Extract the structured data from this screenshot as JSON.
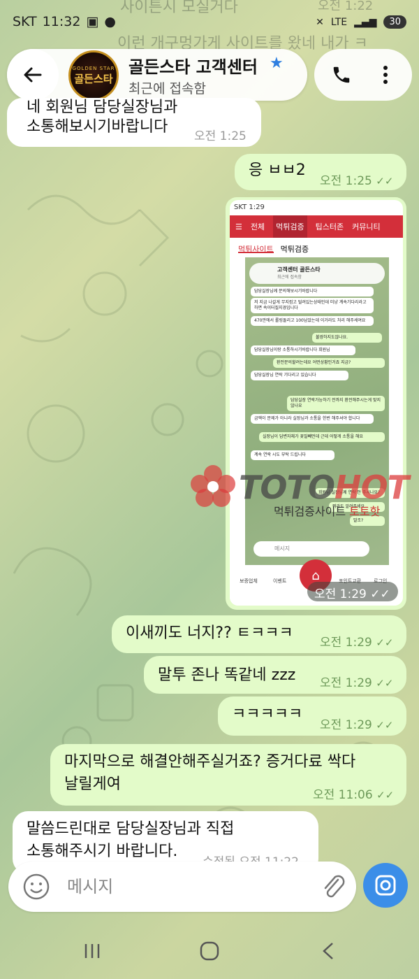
{
  "status_bar": {
    "carrier": "SKT",
    "time": "11:32",
    "network": "LTE",
    "battery": "30"
  },
  "ghost_lines": [
    "사이튼시 모실거다",
    "이런 개구멍가게 사이트를 왔네 내가 ㅋ"
  ],
  "ghost_time": "오전 1:22",
  "header": {
    "title": "골든스타 고객센터",
    "status": "최근에 접속함",
    "avatar_top": "GOLDEN STAR",
    "avatar_main": "골든스타"
  },
  "messages": [
    {
      "dir": "in",
      "lines": [
        "네 회원님 담당실장님과",
        "소통해보시기바랍니다"
      ],
      "time": "오전 1:25"
    },
    {
      "dir": "out",
      "lines": [
        "응 ㅂㅂ2"
      ],
      "time": "오전 1:25"
    },
    {
      "dir": "out",
      "lines": [
        "이새끼도 너지?? ㅌㅋㅋㅋ"
      ],
      "time": "오전 1:29"
    },
    {
      "dir": "out",
      "lines": [
        "말투 존나 똑같네 zzz"
      ],
      "time": "오전 1:29"
    },
    {
      "dir": "out",
      "lines": [
        "ㅋㅋㅋㅋㅋ"
      ],
      "time": "오전 1:29"
    },
    {
      "dir": "out",
      "lines": [
        "마지막으로 해결안해주실거죠? 증거다료 싹다",
        "날릴게여"
      ],
      "time": "오전 11:06"
    },
    {
      "dir": "in",
      "lines": [
        "말씀드린대로 담당실장님과 직접",
        "소통해주시기 바랍니다."
      ],
      "time": "수정됨 오전 11:22"
    }
  ],
  "screenshot": {
    "time": "오전 1:29",
    "mini_status": "SKT 1:29",
    "nav_tabs": [
      "전체",
      "먹튀검증",
      "팁스터존",
      "커뮤니티"
    ],
    "sub_tabs": [
      "먹튀사이트",
      "먹튀검증"
    ],
    "mini_title": "고객센터 골든스타",
    "mini_subtitle": "최근에 접속함",
    "mini_messages": [
      {
        "dir": "i",
        "text": "담당실장님께 문의해보시기바랍니다"
      },
      {
        "dir": "i",
        "text": "저 지금 나갈게 무지컴고 털려있는상태인데 미냥 계속기다리라고 하면 속이터질지경입니다"
      },
      {
        "dir": "i",
        "text": "470만에서 롤링돌리고 100남았는데 이거라도 처리 해주세여요"
      },
      {
        "dir": "o",
        "text": "불쌍하지도않나요."
      },
      {
        "dir": "i",
        "text": "담당실장님이랑 소통하시기바랍니다 회원님"
      },
      {
        "dir": "o",
        "text": "환전문의할려는데요 어떤상황인거죠 지금?"
      },
      {
        "dir": "i",
        "text": "담당실장님 연락 기다리고 있습니다"
      },
      {
        "dir": "o",
        "text": "담당실장 연락가능하기 전까지 환전해주시는게 맞지않나요"
      },
      {
        "dir": "i",
        "text": "금액이 문제가 아니라 실장님과 소통을 한번 해주셔야 합니다"
      },
      {
        "dir": "o",
        "text": "실장님이 답변자체가 꽃밀빼먼데 근데 어떻게 소통을 해요"
      },
      {
        "dir": "i",
        "text": "계속 연락 시도 부탁 드립니다"
      },
      {
        "dir": "o",
        "text": "회원님 실장님께 연락 안 주시나요?"
      },
      {
        "dir": "o",
        "text": "뭐라도 알려주세요"
      },
      {
        "dir": "o",
        "text": "말조?"
      }
    ],
    "mini_input": "메시지",
    "bottom_items": [
      "보증업체",
      "이벤트",
      "포인트교환",
      "로그인"
    ],
    "watermark_red": "TOTO",
    "watermark_dark": "HOT",
    "watermark_sub": "먹튀검증사이트",
    "watermark_sub_red": "토토핫"
  },
  "composer": {
    "placeholder": "메시지"
  },
  "colors": {
    "out_bubble": "#e3fbc9",
    "in_bubble": "#ffffff",
    "accent": "#3b8ee8",
    "site_red": "#d32f3a",
    "check_green": "#6e9a5a"
  },
  "icons": [
    "back-arrow-icon",
    "star-icon",
    "phone-icon",
    "more-vert-icon",
    "emoji-icon",
    "paperclip-icon",
    "camera-icon",
    "nav-recents-icon",
    "nav-home-icon",
    "nav-back-icon"
  ]
}
